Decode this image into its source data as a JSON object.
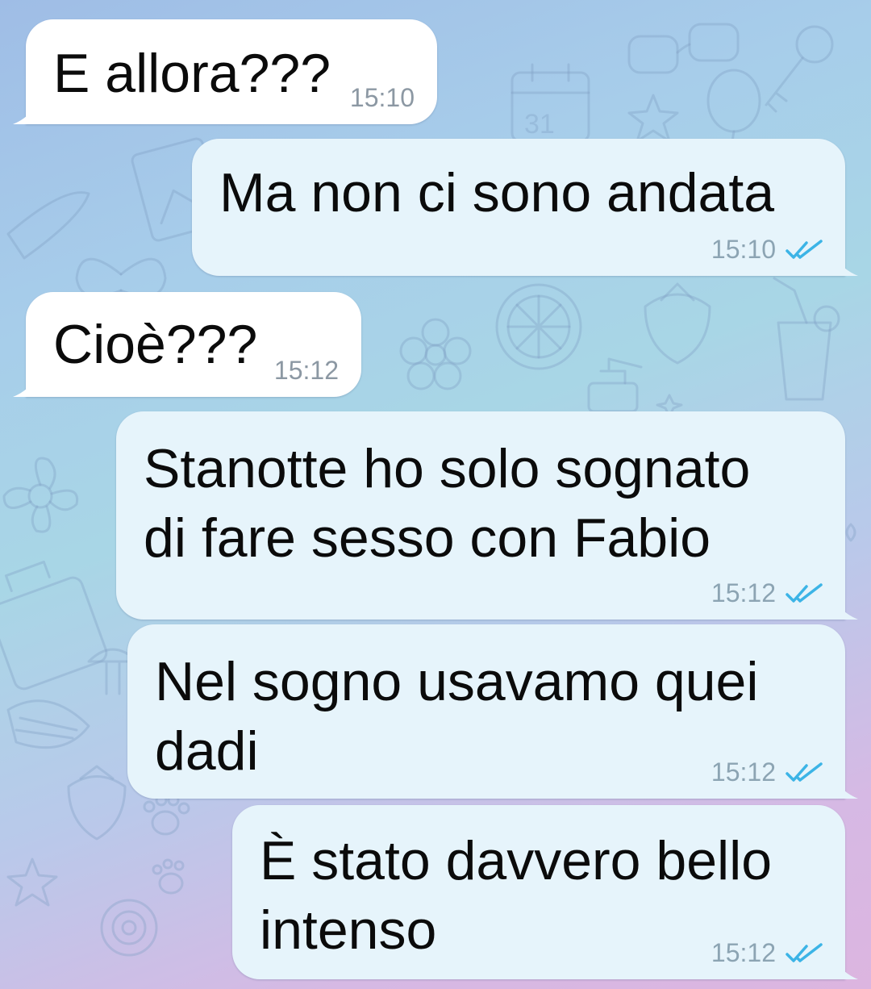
{
  "chat": {
    "messages": [
      {
        "direction": "incoming",
        "text": "E allora???",
        "time": "15:10"
      },
      {
        "direction": "outgoing",
        "text": "Ma non ci sono andata",
        "time": "15:10",
        "status": "read"
      },
      {
        "direction": "incoming",
        "text": "Cioè???",
        "time": "15:12"
      },
      {
        "direction": "outgoing",
        "text": "Stanotte ho solo sognato\ndi fare sesso con Fabio",
        "time": "15:12",
        "status": "read"
      },
      {
        "direction": "outgoing",
        "text": "Nel sogno usavamo quei\ndadi",
        "time": "15:12",
        "status": "read"
      },
      {
        "direction": "outgoing",
        "text": "È stato davvero bello\nintenso",
        "time": "15:12",
        "status": "read"
      }
    ]
  },
  "icons": {
    "read_receipt": "double-check-icon"
  },
  "colors": {
    "incoming_bubble": "#ffffff",
    "outgoing_bubble": "#e6f4fb",
    "read_tick": "#3cb4e6",
    "timestamp": "#8c98a3"
  }
}
